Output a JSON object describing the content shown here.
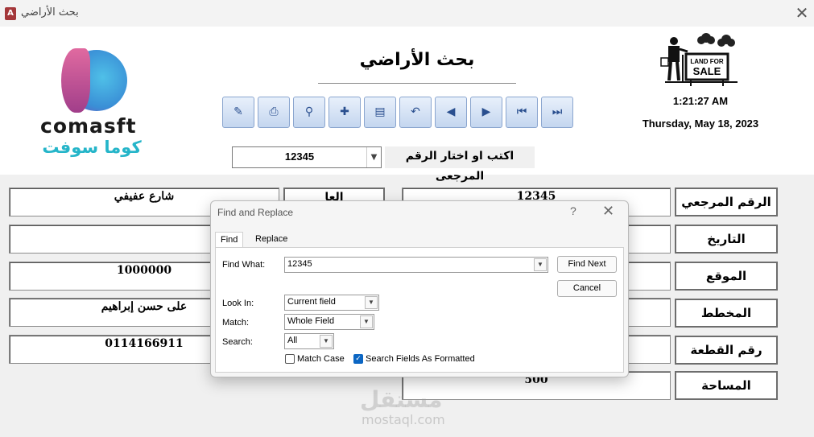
{
  "window": {
    "title": "بحث الأراضي",
    "app_icon": "access-icon",
    "app_icon_text": "A",
    "close_glyph": "✕"
  },
  "header": {
    "form_title": "بحث الأراضي",
    "clock": "1:21:27 AM",
    "date": "Thursday, May 18, 2023",
    "land_sign_line1": "LAND FOR",
    "land_sign_line2": "SALE"
  },
  "logo": {
    "name": "comasft",
    "arabic": "كوما سوفت"
  },
  "toolbar": [
    {
      "icon": "delete-record-icon",
      "glyph": "✎"
    },
    {
      "icon": "print-icon",
      "glyph": "⎙"
    },
    {
      "icon": "find-binoculars-icon",
      "glyph": "⚲"
    },
    {
      "icon": "new-record-icon",
      "glyph": "✚"
    },
    {
      "icon": "save-record-icon",
      "glyph": "▤"
    },
    {
      "icon": "undo-icon",
      "glyph": "↶"
    },
    {
      "icon": "previous-record-icon",
      "glyph": "◀"
    },
    {
      "icon": "next-record-icon",
      "glyph": "▶"
    },
    {
      "icon": "first-record-icon",
      "glyph": "⏮"
    },
    {
      "icon": "last-record-icon",
      "glyph": "⏭"
    }
  ],
  "reference_selector": {
    "value": "12345",
    "label": "اكتب او اختار الرقم المرجعى"
  },
  "fields": {
    "ref_number": {
      "label": "الرقم المرجعي",
      "value": "12345"
    },
    "date": {
      "label": "التاريخ",
      "value": ""
    },
    "location": {
      "label": "الموقع",
      "value": ""
    },
    "plan": {
      "label": "المخطط",
      "value": ""
    },
    "plot_number": {
      "label": "رقم القطعة",
      "value": ""
    },
    "area": {
      "label": "المساحة",
      "value": "500"
    },
    "left": {
      "street": "شارع عفيفي",
      "row2": "",
      "price": "1000000",
      "owner": "على حسن إبراهيم",
      "phone": "0114166911",
      "side_label": "العا"
    }
  },
  "dialog": {
    "title": "Find and Replace",
    "help": "?",
    "close": "✕",
    "tabs": [
      "Find",
      "Replace"
    ],
    "find_what_label": "Find What:",
    "find_what_value": "12345",
    "find_next": "Find Next",
    "cancel": "Cancel",
    "look_in_label": "Look In:",
    "look_in_value": "Current field",
    "match_label": "Match:",
    "match_value": "Whole Field",
    "search_label": "Search:",
    "search_value": "All",
    "match_case_label": "Match Case",
    "match_case_checked": false,
    "formatted_label": "Search Fields As Formatted",
    "formatted_checked": true
  },
  "watermark": {
    "arabic": "مستقل",
    "latin": "mostaql.com"
  }
}
